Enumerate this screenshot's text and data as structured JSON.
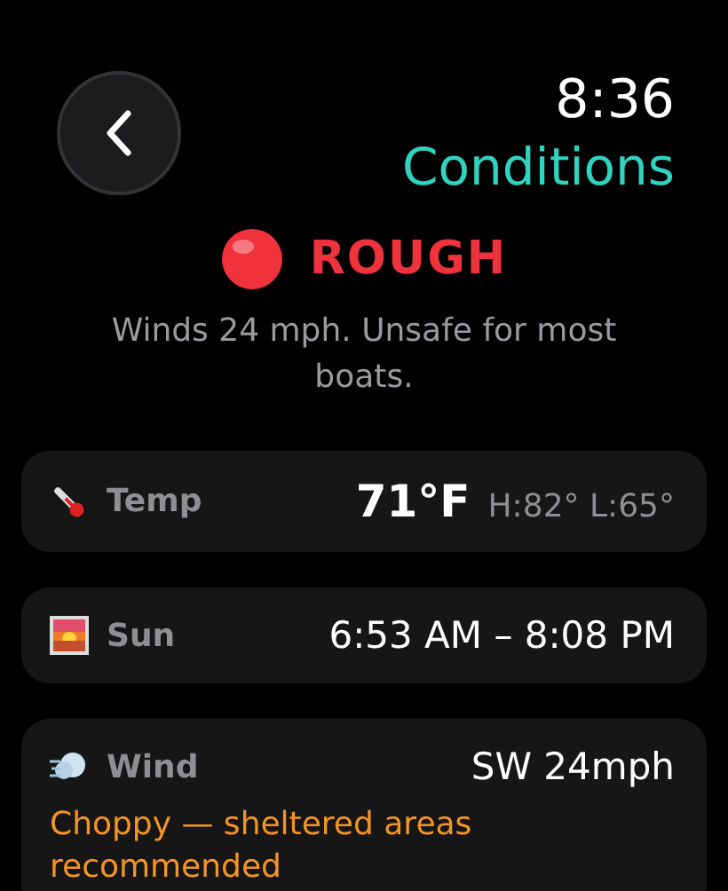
{
  "time": "8:36",
  "title": "Conditions",
  "status": {
    "label": "ROUGH",
    "color": "#f0323c",
    "message": "Winds 24 mph. Unsafe for most boats."
  },
  "cards": [
    {
      "kind": "temp",
      "label": "Temp",
      "value": "71°F",
      "detail": "H:82° L:65°"
    },
    {
      "kind": "sun",
      "label": "Sun",
      "value": "6:53 AM – 8:08 PM"
    },
    {
      "kind": "wind",
      "label": "Wind",
      "value": "SW 24mph",
      "note": "Choppy — sheltered areas recommended"
    }
  ]
}
